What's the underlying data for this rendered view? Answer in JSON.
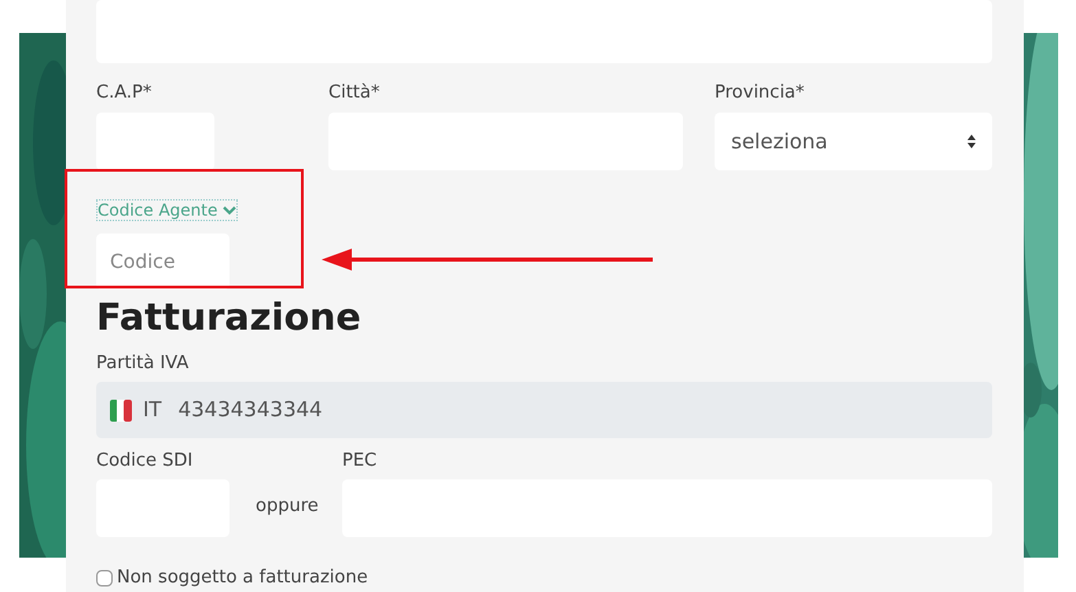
{
  "address_row": [
    {
      "label": "C.A.P*",
      "kind": "input"
    },
    {
      "label": "Città*",
      "kind": "input"
    },
    {
      "label": "Provincia*",
      "kind": "select",
      "value": "seleziona"
    }
  ],
  "agent": {
    "selector": "Codice Agente",
    "placeholder": "Codice"
  },
  "billing": {
    "heading": "Fatturazione",
    "vat_label": "Partità IVA",
    "country": "IT",
    "vat_value": "43434343344",
    "sdi_label": "Codice SDI",
    "separator": "oppure",
    "pec_label": "PEC",
    "exempt": {
      "label": "Non soggetto a fatturazione",
      "checked": false
    }
  },
  "annotation": {
    "kind": "highlight-arrow"
  }
}
